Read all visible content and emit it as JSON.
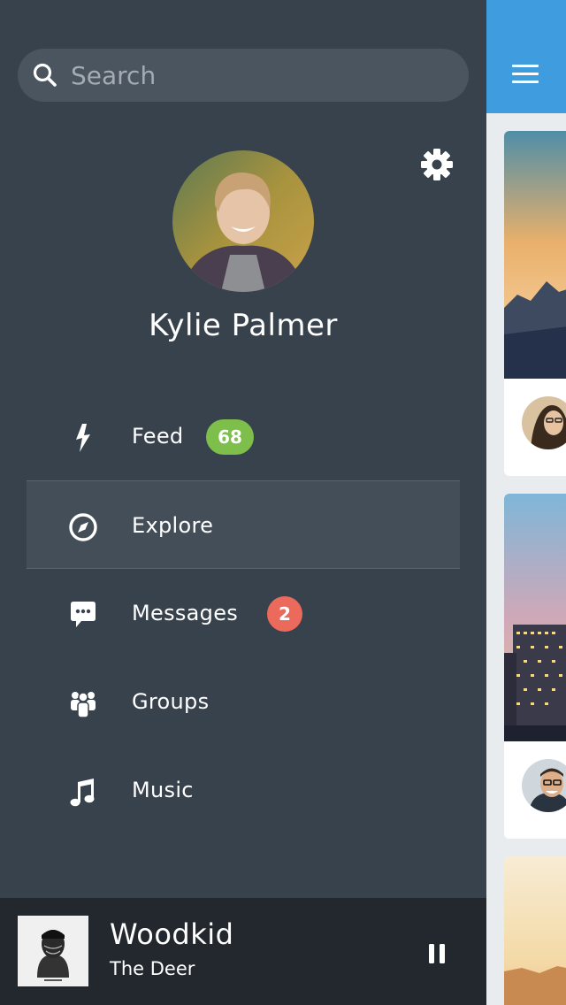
{
  "search": {
    "placeholder": "Search"
  },
  "profile": {
    "name": "Kylie Palmer"
  },
  "menu": {
    "items": [
      {
        "label": "Feed",
        "icon": "bolt-icon",
        "badge": "68",
        "badge_color": "#7dbf4a"
      },
      {
        "label": "Explore",
        "icon": "compass-icon",
        "active": true
      },
      {
        "label": "Messages",
        "icon": "chat-bubble-icon",
        "badge": "2",
        "badge_color": "#ec6a5c"
      },
      {
        "label": "Groups",
        "icon": "people-icon"
      },
      {
        "label": "Music",
        "icon": "music-note-icon"
      }
    ]
  },
  "player": {
    "artist": "Woodkid",
    "title": "The Deer",
    "state_icon": "pause-icon"
  },
  "colors": {
    "drawer_bg": "#38424c",
    "player_bg": "#22282e",
    "accent_blue": "#3f9cde",
    "badge_green": "#7dbf4a",
    "badge_red": "#ec6a5c"
  }
}
